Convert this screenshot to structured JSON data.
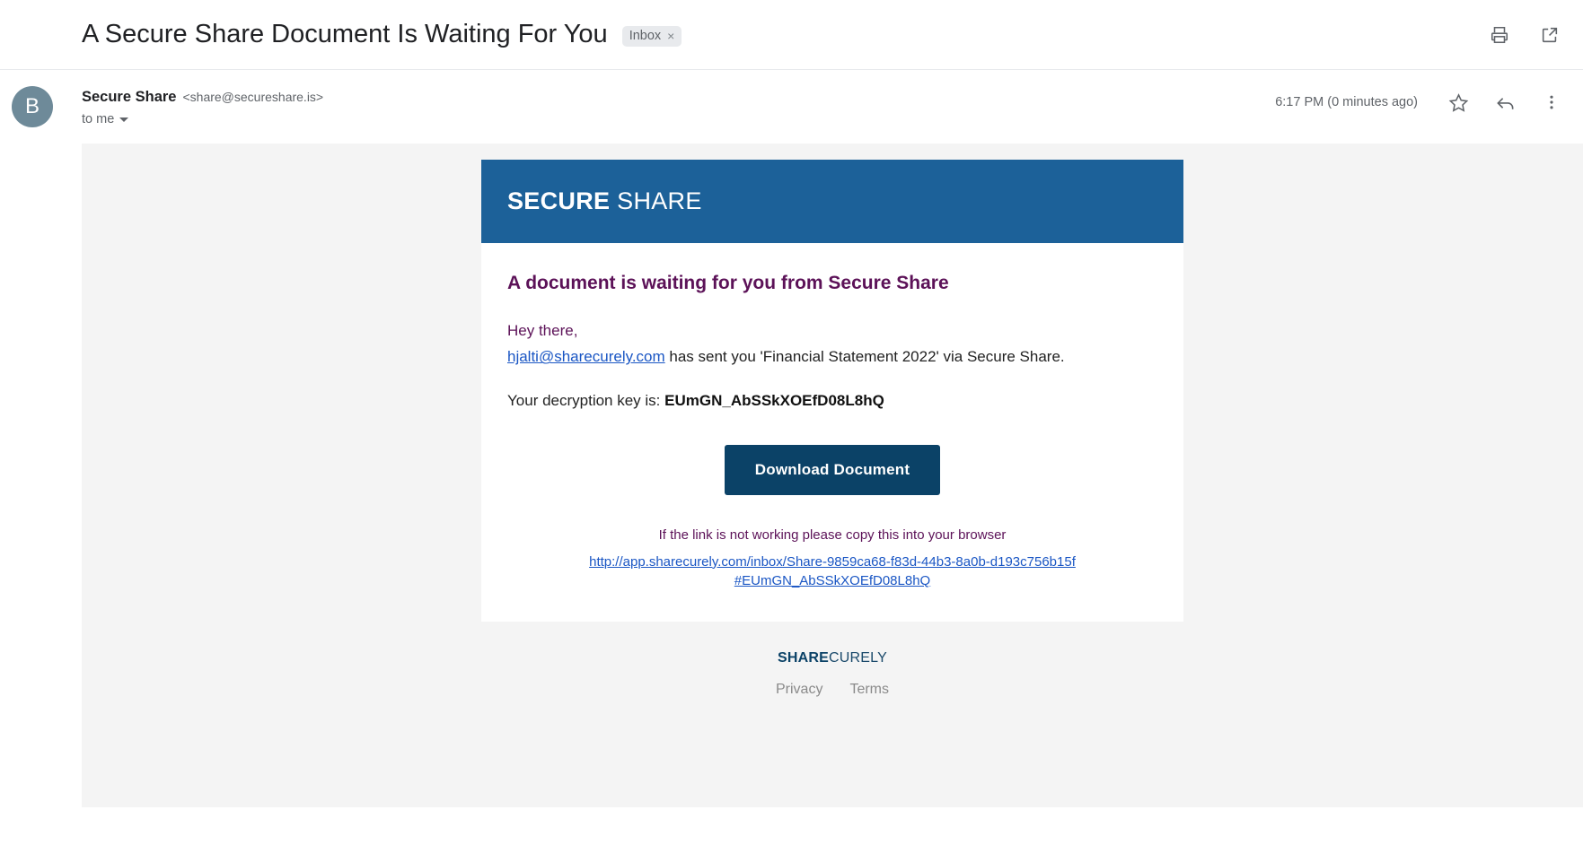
{
  "subject": {
    "title": "A Secure Share Document Is Waiting For You",
    "label": "Inbox",
    "label_remove": "×",
    "print_icon": "print-icon",
    "popout_icon": "open-in-new-window-icon"
  },
  "message": {
    "avatar_initial": "B",
    "sender_name": "Secure Share",
    "sender_email": "<share@secureshare.is>",
    "recipient": "to me",
    "timestamp": "6:17 PM (0 minutes ago)",
    "star_icon": "star-icon",
    "reply_icon": "reply-icon",
    "more_icon": "more-options-icon"
  },
  "mail": {
    "banner": {
      "logo_bold": "SECURE",
      "logo_light": " SHARE"
    },
    "heading": "A document is waiting for you from Secure Share",
    "greeting": "Hey there,",
    "sender_link": "hjalti@sharecurely.com",
    "body_text": " has sent you 'Financial Statement 2022' via Secure Share.",
    "key_label": "Your decryption key is: ",
    "key_value": "EUmGN_AbSSkXOEfD08L8hQ",
    "download_button": "Download Document",
    "fallback_note": "If the link is not working please copy this into your browser",
    "fallback_url": "http://app.sharecurely.com/inbox/Share-9859ca68-f83d-44b3-8a0b-d193c756b15f#EUmGN_AbSSkXOEfD08L8hQ"
  },
  "footer": {
    "logo_bold": "SHARE",
    "logo_light": "CURELY",
    "links": [
      {
        "label": "Privacy"
      },
      {
        "label": "Terms"
      }
    ]
  },
  "colors": {
    "banner_blue": "#1c6199",
    "button_navy": "#0b4267",
    "heading_purple": "#5c1258",
    "link_blue": "#1a56c4",
    "avatar_gray": "#6e8a99",
    "body_bg": "#f4f4f4"
  }
}
